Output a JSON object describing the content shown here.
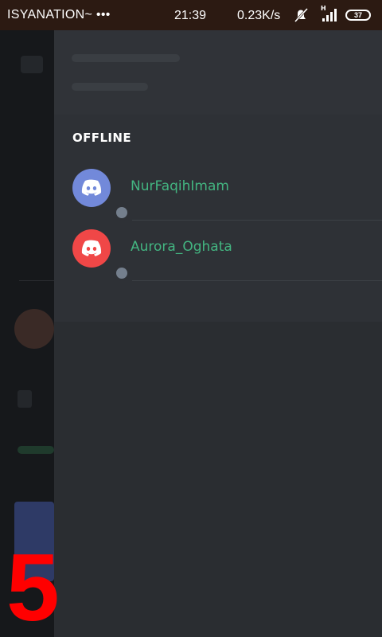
{
  "status_bar": {
    "carrier": "ISYANATION~ •••",
    "time": "21:39",
    "network_speed": "0.23K/s",
    "battery": "37",
    "icons": [
      "mute-icon",
      "signal-icon",
      "battery-icon"
    ]
  },
  "member_list": {
    "section_title": "OFFLINE",
    "members": [
      {
        "name": "NurFaqihImam",
        "avatar_color": "#7289da",
        "status": "offline"
      },
      {
        "name": "Aurora_Oghata",
        "avatar_color": "#f04747",
        "status": "offline"
      }
    ]
  },
  "overlay": {
    "step_number": "5"
  },
  "colors": {
    "username": "#43b581",
    "offline_dot": "#747f8d",
    "background": "#2a2d31"
  }
}
